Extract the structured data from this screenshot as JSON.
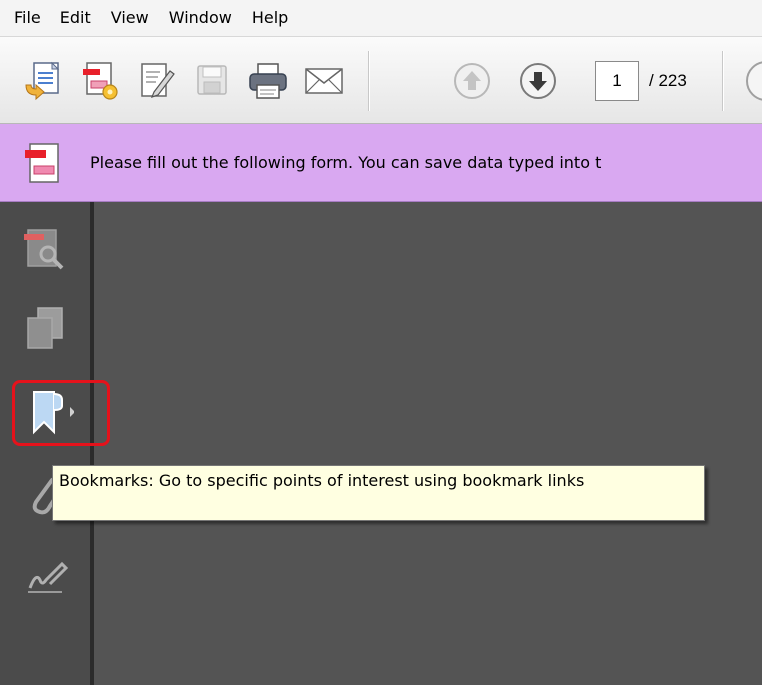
{
  "menubar": {
    "items": [
      "File",
      "Edit",
      "View",
      "Window",
      "Help"
    ]
  },
  "toolbar": {
    "buttons": [
      {
        "name": "create-pdf-icon"
      },
      {
        "name": "form-wizard-icon"
      },
      {
        "name": "edit-document-icon"
      },
      {
        "name": "save-icon"
      },
      {
        "name": "print-icon"
      },
      {
        "name": "email-icon"
      },
      {
        "name": "page-up-icon"
      },
      {
        "name": "page-down-icon"
      }
    ],
    "page": {
      "current": "1",
      "total": "/ 223"
    }
  },
  "formbar": {
    "message": "Please fill out the following form. You can save data typed into t"
  },
  "sidebar": {
    "icons": [
      "page-thumbnails-icon",
      "pages-icon",
      "bookmark-icon",
      "attachment-icon",
      "signature-icon"
    ]
  },
  "tooltip": {
    "text": "Bookmarks: Go to specific points of interest using bookmark links"
  },
  "colors": {
    "formbar": "#d9a8f1",
    "sidebar": "#4b4b4b",
    "document": "#545454",
    "highlight": "#e5121b",
    "tooltip": "#ffffe1"
  }
}
